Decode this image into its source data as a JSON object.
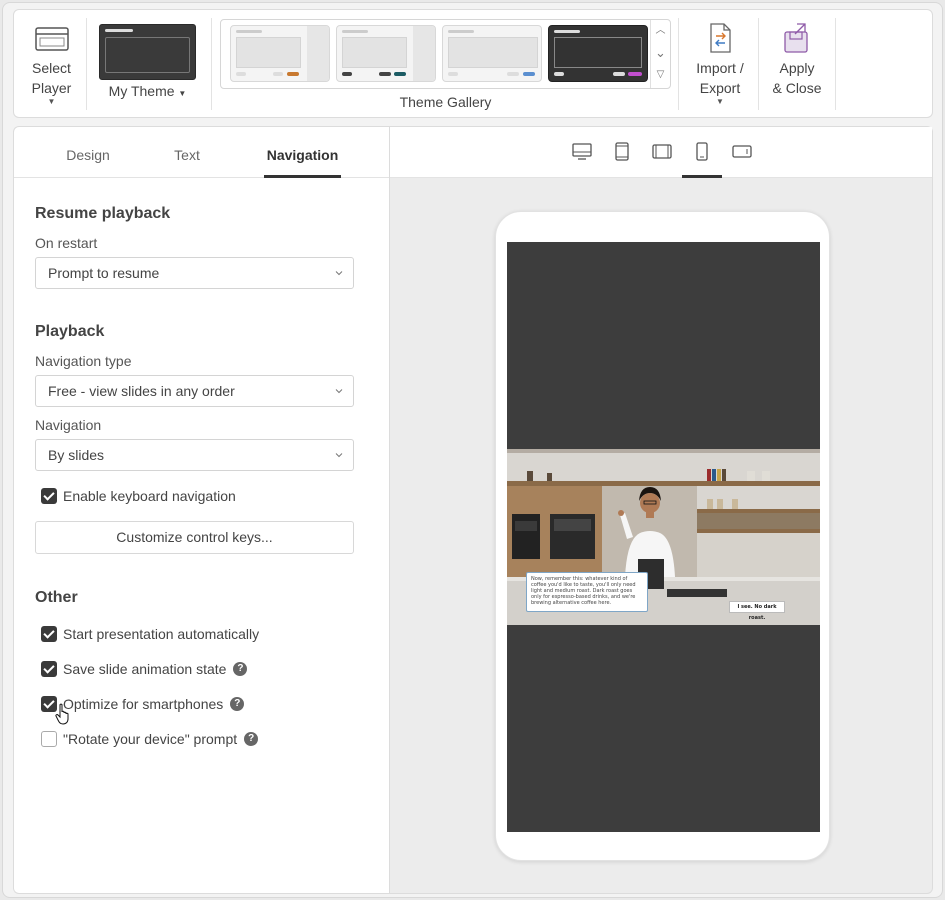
{
  "ribbon": {
    "select_player_line1": "Select",
    "select_player_line2": "Player",
    "my_theme_label": "My Theme",
    "gallery_label": "Theme Gallery",
    "import_export_line1": "Import /",
    "import_export_line2": "Export",
    "apply_close_line1": "Apply",
    "apply_close_line2": "& Close"
  },
  "tabs": [
    {
      "label": "Design",
      "active": false
    },
    {
      "label": "Text",
      "active": false
    },
    {
      "label": "Navigation",
      "active": true
    }
  ],
  "resume": {
    "title": "Resume playback",
    "on_restart_label": "On restart",
    "on_restart_value": "Prompt to resume"
  },
  "playback": {
    "title": "Playback",
    "nav_type_label": "Navigation type",
    "nav_type_value": "Free - view slides in any order",
    "navigation_label": "Navigation",
    "navigation_value": "By slides",
    "keyboard_nav_label": "Enable keyboard navigation",
    "keyboard_nav_checked": true,
    "customize_keys_label": "Customize control keys..."
  },
  "other": {
    "title": "Other",
    "items": [
      {
        "label": "Start presentation automatically",
        "checked": true,
        "help": false
      },
      {
        "label": "Save slide animation state",
        "checked": true,
        "help": true
      },
      {
        "label": "Optimize for smartphones",
        "checked": true,
        "help": true
      },
      {
        "label": "\"Rotate your device\" prompt",
        "checked": false,
        "help": true
      }
    ]
  },
  "devices": [
    "desktop-icon",
    "tablet-portrait-icon",
    "tablet-landscape-icon",
    "smartphone-portrait-icon",
    "smartphone-landscape-icon"
  ],
  "preview": {
    "callout_text": "Now, remember this: whatever kind of coffee you'd like to taste, you'll only need light and medium roast. Dark roast goes only for espresso-based drinks, and we're brewing alternative coffee here.",
    "reply_text": "I see. No dark roast."
  },
  "colors": {
    "accent": "#333333",
    "screen_bg": "#3d3d3d",
    "callout_border": "#7fa6c7"
  }
}
